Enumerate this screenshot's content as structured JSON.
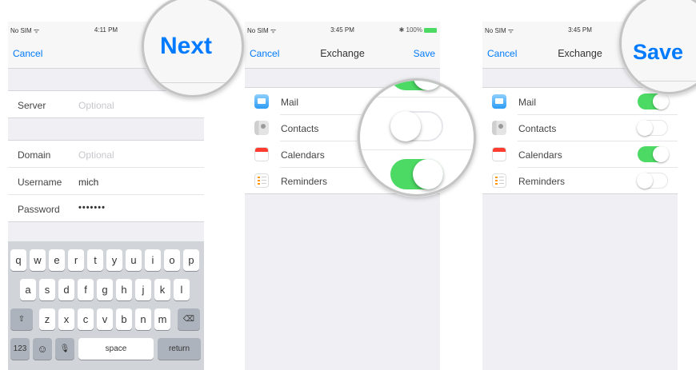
{
  "screen1": {
    "status": {
      "carrier": "No SIM ᯤ",
      "time": "4:11 PM"
    },
    "nav": {
      "left": "Cancel"
    },
    "server": {
      "label": "Server",
      "placeholder": "Optional"
    },
    "domain": {
      "label": "Domain",
      "placeholder": "Optional"
    },
    "username": {
      "label": "Username",
      "value": "mich"
    },
    "password": {
      "label": "Password",
      "value": "•••••••"
    },
    "magnified_label": "Next",
    "keyboard": {
      "row1": [
        "q",
        "w",
        "e",
        "r",
        "t",
        "y",
        "u",
        "i",
        "o",
        "p"
      ],
      "row2": [
        "a",
        "s",
        "d",
        "f",
        "g",
        "h",
        "j",
        "k",
        "l"
      ],
      "row3": [
        "z",
        "x",
        "c",
        "v",
        "b",
        "n",
        "m"
      ],
      "shift": "⇧",
      "delete": "⌫",
      "numbers": "123",
      "emoji": "☺",
      "mic": "🎙",
      "space": "space",
      "return": "return"
    }
  },
  "screen2": {
    "status": {
      "carrier": "No SIM ᯤ",
      "time": "3:45 PM",
      "battery": "✱ 100%"
    },
    "nav": {
      "left": "Cancel",
      "title": "Exchange",
      "right": "Save"
    },
    "services": [
      {
        "label": "Mail",
        "icon": "mail-icon",
        "on": true
      },
      {
        "label": "Contacts",
        "icon": "contacts-icon",
        "on": false
      },
      {
        "label": "Calendars",
        "icon": "calendar-icon",
        "on": true
      },
      {
        "label": "Reminders",
        "icon": "reminders-icon",
        "on": false
      }
    ]
  },
  "screen3": {
    "status": {
      "carrier": "No SIM ᯤ",
      "time": "3:45 PM"
    },
    "nav": {
      "left": "Cancel",
      "title": "Exchange"
    },
    "magnified_label": "Save",
    "services": [
      {
        "label": "Mail",
        "icon": "mail-icon",
        "on": true
      },
      {
        "label": "Contacts",
        "icon": "contacts-icon",
        "on": false
      },
      {
        "label": "Calendars",
        "icon": "calendar-icon",
        "on": true
      },
      {
        "label": "Reminders",
        "icon": "reminders-icon",
        "on": false
      }
    ]
  },
  "colors": {
    "accent": "#007aff",
    "toggle_on": "#4cd964",
    "background": "#efeff4"
  }
}
